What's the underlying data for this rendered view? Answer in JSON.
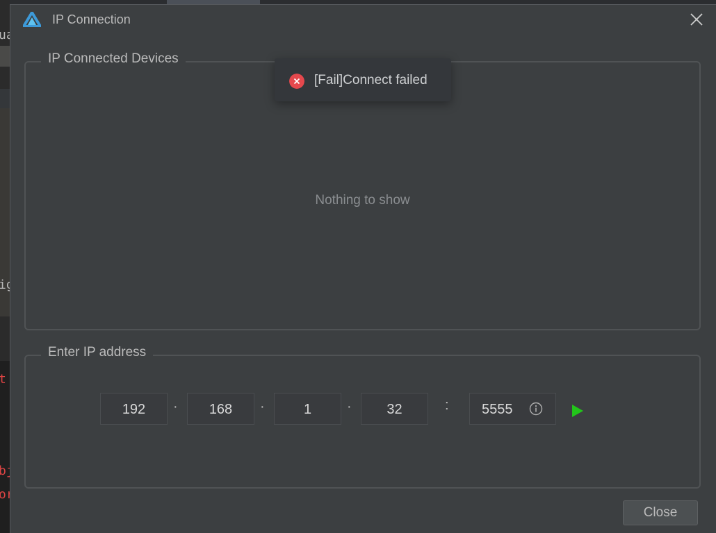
{
  "background": {
    "fragments": [
      "ua",
      "ig",
      "t",
      "bj",
      "or"
    ]
  },
  "dialog": {
    "title": "IP Connection",
    "app_icon": "app-logo-icon",
    "close_icon": "close-icon"
  },
  "devices_group": {
    "legend": "IP Connected Devices",
    "empty_text": "Nothing to show"
  },
  "toast": {
    "icon": "error-circle-icon",
    "message": "[Fail]Connect failed",
    "color": "#e5484d"
  },
  "ip_group": {
    "legend": "Enter IP address",
    "octets": [
      "192",
      "168",
      "1",
      "32"
    ],
    "dot_separator": "·",
    "port_separator": ":",
    "port": "5555",
    "info_icon": "info-icon",
    "connect_icon": "play-icon",
    "connect_color": "#22c51a"
  },
  "footer": {
    "close_label": "Close"
  }
}
